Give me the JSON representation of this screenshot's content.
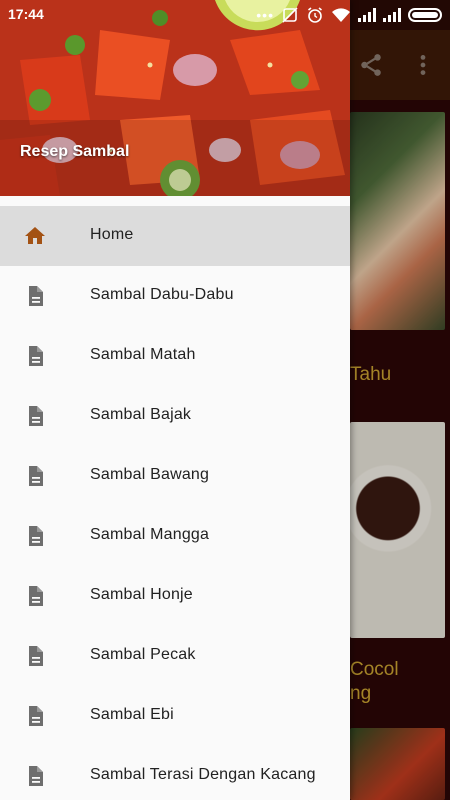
{
  "status_bar": {
    "time": "17:44",
    "icons": [
      "more-dots-icon",
      "data-saver-icon",
      "alarm-icon",
      "wifi-icon",
      "signal-icon",
      "signal-icon",
      "battery-icon"
    ]
  },
  "background": {
    "cards": [
      {
        "title": "Tahu"
      },
      {
        "title": "Cocol"
      },
      {
        "title": "ng"
      }
    ]
  },
  "drawer": {
    "title": "Resep Sambal",
    "items": [
      {
        "label": "Home",
        "icon": "home-icon",
        "active": true
      },
      {
        "label": "Sambal Dabu-Dabu",
        "icon": "document-icon"
      },
      {
        "label": "Sambal Matah",
        "icon": "document-icon"
      },
      {
        "label": "Sambal Bajak",
        "icon": "document-icon"
      },
      {
        "label": "Sambal Bawang",
        "icon": "document-icon"
      },
      {
        "label": "Sambal Mangga",
        "icon": "document-icon"
      },
      {
        "label": "Sambal Honje",
        "icon": "document-icon"
      },
      {
        "label": "Sambal Pecak",
        "icon": "document-icon"
      },
      {
        "label": "Sambal Ebi",
        "icon": "document-icon"
      },
      {
        "label": "Sambal Terasi Dengan Kacang",
        "icon": "document-icon"
      }
    ]
  },
  "colors": {
    "accent": "#a35214",
    "doc_icon": "#6e6e6e",
    "active_bg": "#dcdcdc",
    "appbar": "#3d1a08",
    "card_title": "#c9a230"
  }
}
